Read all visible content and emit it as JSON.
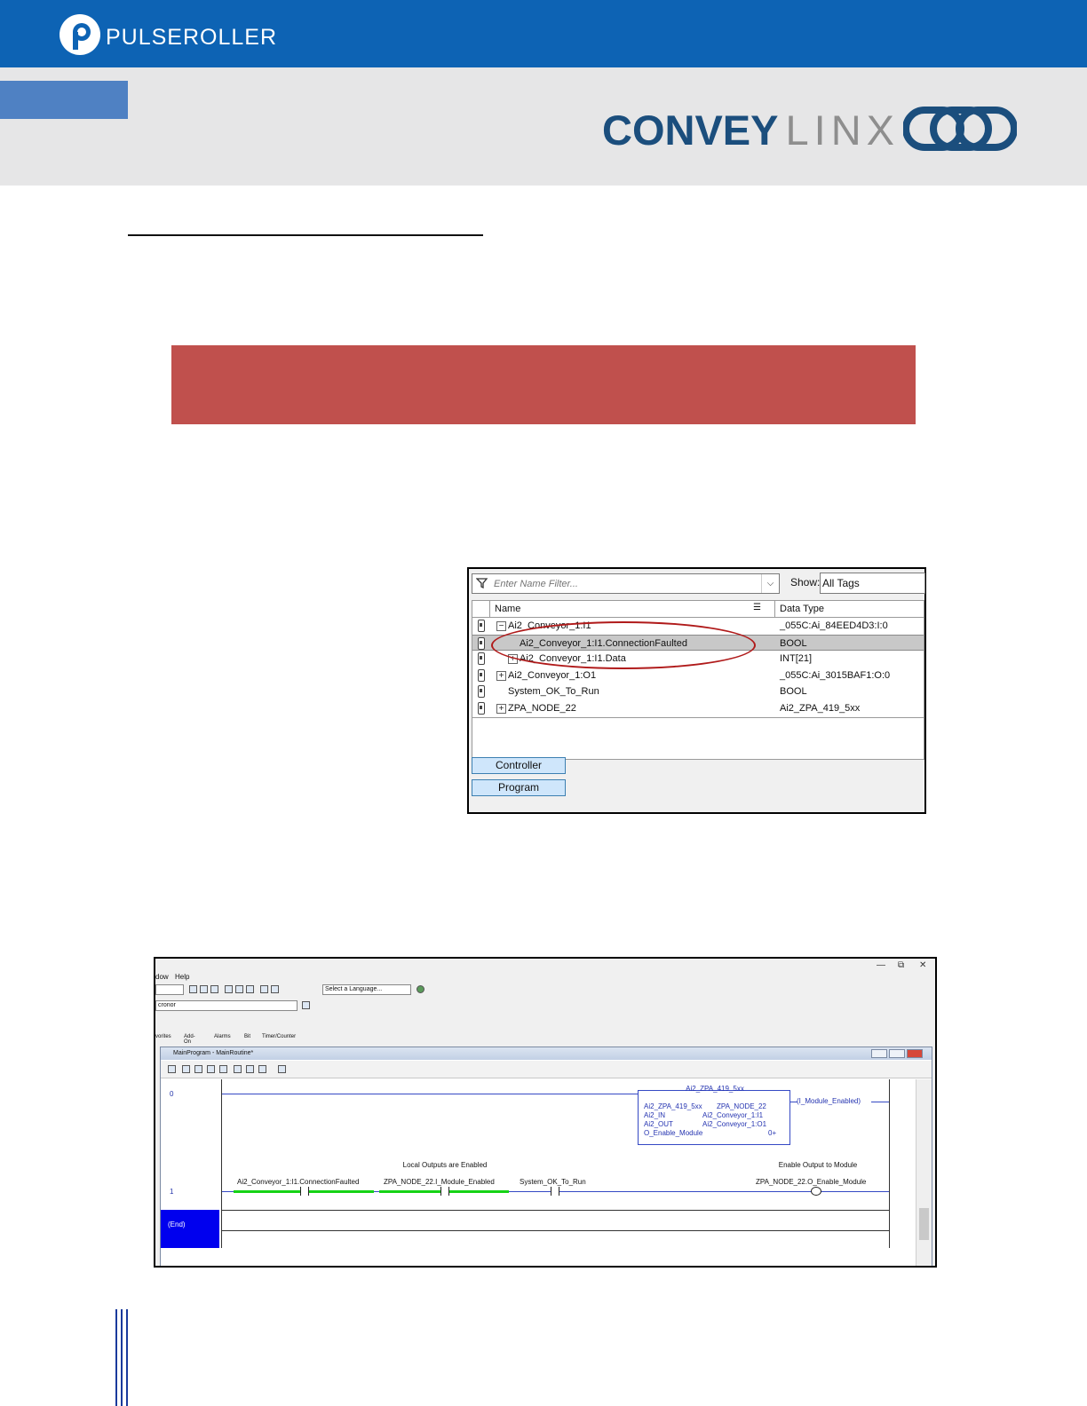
{
  "header": {
    "brand": "PULSEROLLER",
    "product_bold": "CONVEY",
    "product_light": "LINX",
    "brand_color": "#0d63b4"
  },
  "tag_browser": {
    "filter_placeholder": "Enter Name Filter...",
    "show_label": "Show:",
    "show_value": "All Tags",
    "columns": {
      "name": "Name",
      "data_type": "Data Type"
    },
    "rows": [
      {
        "name": "Ai2_Conveyor_1:I1",
        "type": "_055C:Ai_84EED4D3:I:0",
        "expander": "−",
        "indent": 0
      },
      {
        "name": "Ai2_Conveyor_1:I1.ConnectionFaulted",
        "type": "BOOL",
        "expander": "",
        "indent": 1,
        "selected": true
      },
      {
        "name": "Ai2_Conveyor_1:I1.Data",
        "type": "INT[21]",
        "expander": "+",
        "indent": 1
      },
      {
        "name": "Ai2_Conveyor_1:O1",
        "type": "_055C:Ai_3015BAF1:O:0",
        "expander": "+",
        "indent": 0
      },
      {
        "name": "System_OK_To_Run",
        "type": "BOOL",
        "expander": "",
        "indent": 0
      },
      {
        "name": "ZPA_NODE_22",
        "type": "Ai2_ZPA_419_5xx",
        "expander": "+",
        "indent": 0
      }
    ],
    "controller_button": "Controller",
    "program_button": "Program"
  },
  "ladder_window": {
    "menu_window": "dow",
    "menu_help": "Help",
    "window_controls": {
      "minimize": "—",
      "restore": "⧉",
      "close": "✕"
    },
    "language_select": "Select a Language...",
    "project_field": "cronor",
    "tabs": [
      "vorites",
      "Add-On",
      "Alarms",
      "Bit",
      "Timer/Counter"
    ],
    "mdi_title": "MainProgram - MainRoutine*",
    "rung0": {
      "number": "0",
      "aoi_title": "Ai2_ZPA_419_5xx",
      "aoi_rows": [
        {
          "param": "Ai2_ZPA_419_5xx",
          "value": "ZPA_NODE_22"
        },
        {
          "param": "Ai2_IN",
          "value": "Ai2_Conveyor_1:I1"
        },
        {
          "param": "Ai2_OUT",
          "value": "Ai2_Conveyor_1:O1"
        },
        {
          "param": "O_Enable_Module",
          "value": "0+"
        }
      ],
      "output": "(I_Module_Enabled)"
    },
    "rung1": {
      "number": "1",
      "comment_local": "Local Outputs are Enabled",
      "comment_enable": "Enable Output to Module",
      "contact1": "Ai2_Conveyor_1:I1.ConnectionFaulted",
      "contact2": "ZPA_NODE_22.I_Module_Enabled",
      "contact3": "System_OK_To_Run",
      "coil": "ZPA_NODE_22.O_Enable_Module"
    },
    "end_label": "(End)"
  }
}
